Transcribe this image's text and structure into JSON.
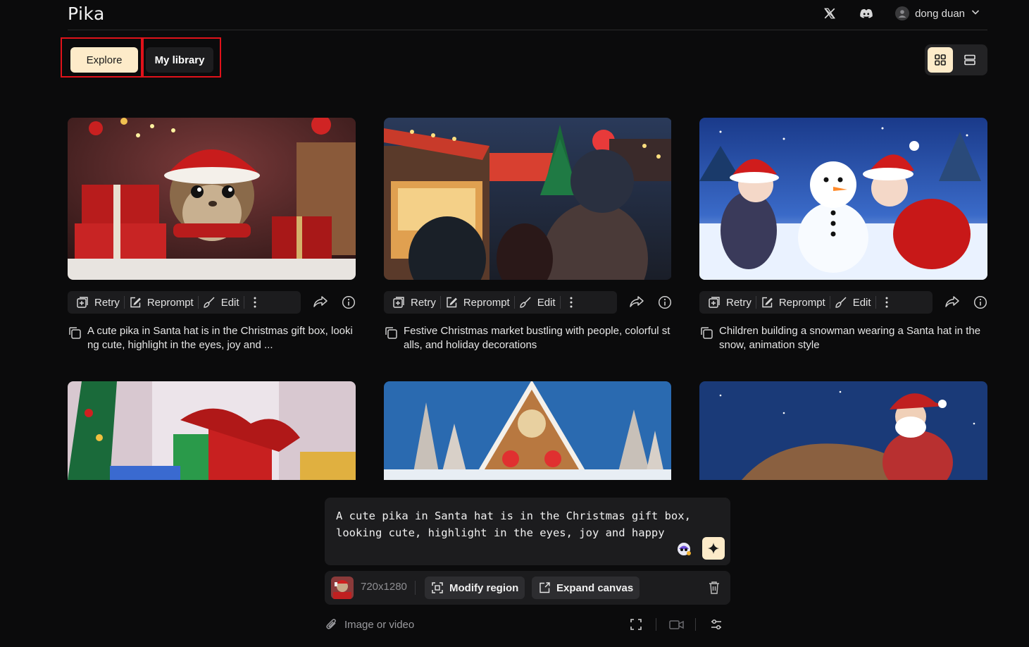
{
  "brand": {
    "logo": "Pika"
  },
  "header": {
    "user_name": "dong duan",
    "icons": [
      "x-logo-icon",
      "discord-icon",
      "user-avatar-icon",
      "chevron-down-icon"
    ]
  },
  "tabs": {
    "explore": "Explore",
    "library": "My library"
  },
  "view_toggle": {
    "options": [
      "grid-view-icon",
      "list-view-icon"
    ],
    "active": "grid"
  },
  "card_actions": {
    "retry": "Retry",
    "reprompt": "Reprompt",
    "edit": "Edit"
  },
  "cards": [
    {
      "caption": "A cute pika in Santa hat is in the Christmas gift box, looking cute, highlight in the eyes, joy and ..."
    },
    {
      "caption": "Festive Christmas market bustling with people, colorful stalls, and holiday decorations"
    },
    {
      "caption": "Children building a snowman wearing a Santa hat in the snow, animation style"
    }
  ],
  "composer": {
    "prompt": "A cute pika in Santa hat is in the Christmas gift box, looking cute, highlight in the eyes, joy and happy",
    "size": "720x1280",
    "modify_region": "Modify region",
    "expand_canvas": "Expand canvas",
    "attach_label": "Image or video"
  },
  "colors": {
    "accent": "#fdebc9",
    "highlight_box": "#e0121a",
    "background": "#0b0b0c",
    "panel": "#1c1c1e"
  }
}
